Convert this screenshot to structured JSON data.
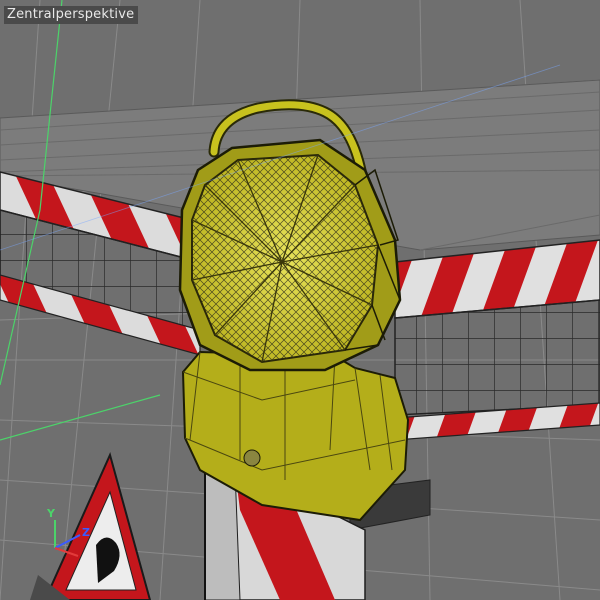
{
  "viewport": {
    "view_name": "Zentralperspektive"
  },
  "axis_gizmo": {
    "labels": [
      "Y",
      "Z"
    ]
  },
  "colors": {
    "background": "#6f6f6f",
    "floor_grid": "#888888",
    "warning_light_yellow": "#c8c21e",
    "barrier_red": "#c4161c",
    "barrier_white": "#dcdcdc",
    "axis_green": "#4cd36a",
    "axis_blue": "#3b5bff"
  },
  "scene_objects": [
    "warning-light",
    "barrier-fence",
    "post",
    "triangle-sign",
    "floor-grid"
  ]
}
